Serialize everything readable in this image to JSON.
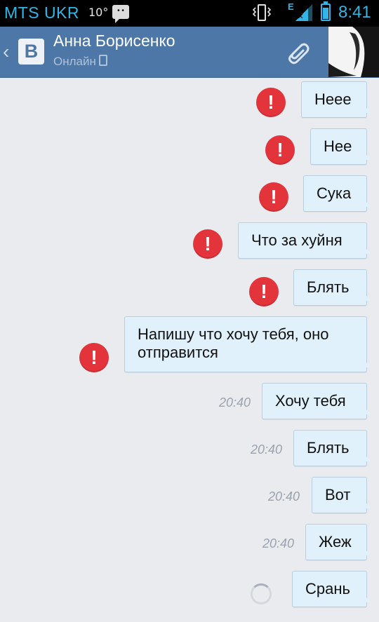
{
  "status_bar": {
    "carrier": "MTS UKR",
    "temperature": "10°",
    "network": "E",
    "time": "8:41"
  },
  "header": {
    "back_icon": "chevron-left-icon",
    "logo_text": "B",
    "contact_name": "Анна Борисенко",
    "contact_status": "Онлайн",
    "attach_icon": "paperclip-icon",
    "accent_color": "#4d77a7"
  },
  "messages": [
    {
      "text": "Неее",
      "state": "failed"
    },
    {
      "text": "Нее",
      "state": "failed"
    },
    {
      "text": "Сука",
      "state": "failed"
    },
    {
      "text": "Что за хуйня",
      "state": "failed"
    },
    {
      "text": "Блять",
      "state": "failed"
    },
    {
      "text": "Напишу что хочу тебя, оно\nотправится",
      "state": "failed"
    },
    {
      "text": "Хочу тебя",
      "state": "sent",
      "time": "20:40"
    },
    {
      "text": "Блять",
      "state": "sent",
      "time": "20:40"
    },
    {
      "text": "Вот",
      "state": "sent",
      "time": "20:40"
    },
    {
      "text": "Жеж",
      "state": "sent",
      "time": "20:40"
    },
    {
      "text": "Срань",
      "state": "sending"
    }
  ],
  "colors": {
    "bubble_bg": "#e1f1fb",
    "error_red": "#e4343b",
    "status_blue": "#33b5e5"
  }
}
